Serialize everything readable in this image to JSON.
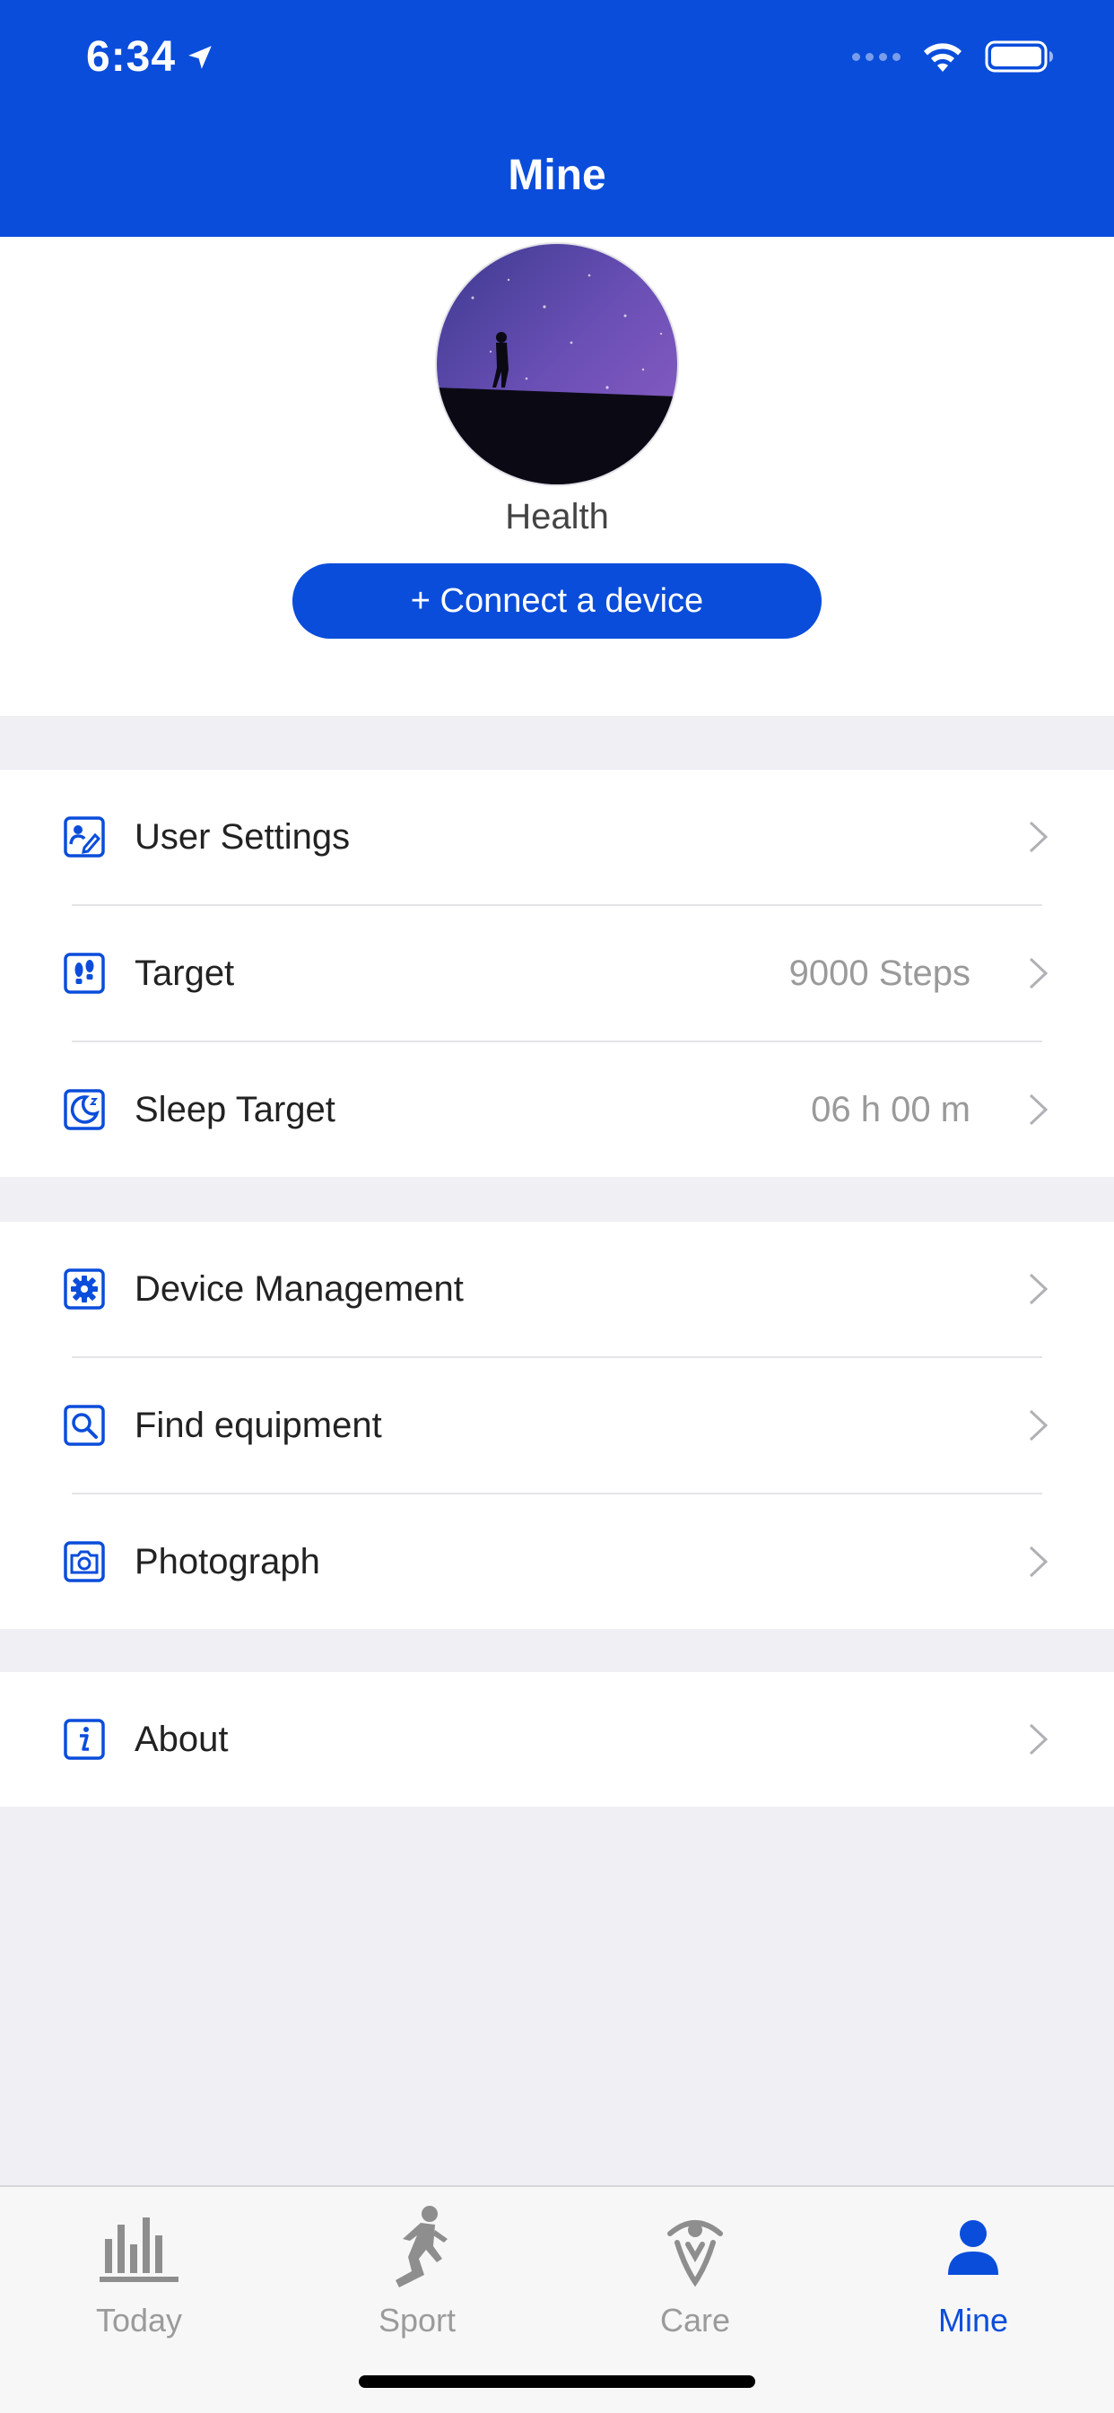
{
  "status_bar": {
    "time": "6:34",
    "location_icon": "location-arrow-icon",
    "wifi_icon": "wifi-icon",
    "battery_icon": "battery-icon"
  },
  "header": {
    "title": "Mine"
  },
  "profile": {
    "avatar": "night-sky-silhouette-avatar",
    "name": "Health",
    "connect_button": "+ Connect a device"
  },
  "settings_group_1": {
    "items": [
      {
        "label": "User Settings",
        "value": "",
        "icon": "user-edit-icon"
      },
      {
        "label": "Target",
        "value": "9000 Steps",
        "icon": "footprints-icon"
      },
      {
        "label": "Sleep Target",
        "value": "06 h 00 m",
        "icon": "moon-sleep-icon"
      }
    ]
  },
  "settings_group_2": {
    "items": [
      {
        "label": "Device Management",
        "icon": "gear-icon"
      },
      {
        "label": "Find equipment",
        "icon": "search-icon"
      },
      {
        "label": "Photograph",
        "icon": "camera-icon"
      }
    ]
  },
  "settings_group_3": {
    "items": [
      {
        "label": "About",
        "icon": "info-icon"
      }
    ]
  },
  "tabbar": {
    "tabs": [
      {
        "label": "Today",
        "icon": "bar-chart-icon",
        "active": false
      },
      {
        "label": "Sport",
        "icon": "runner-icon",
        "active": false
      },
      {
        "label": "Care",
        "icon": "care-person-icon",
        "active": false
      },
      {
        "label": "Mine",
        "icon": "user-icon",
        "active": true
      }
    ]
  },
  "colors": {
    "brand": "#0a4ddb",
    "background": "#efeff4",
    "secondary_text": "#9a9a9a",
    "inactive_tab": "#9b9b9b"
  }
}
